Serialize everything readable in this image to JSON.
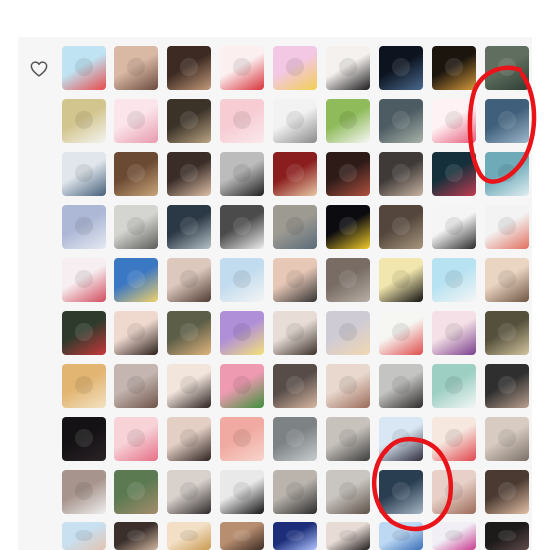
{
  "icons": {
    "like": "heart-outline-icon"
  },
  "colors": {
    "panel_background": "#f6f6f6",
    "annotation_ring": "#e8141a",
    "heart_stroke": "#555555"
  },
  "avatar_rows": [
    [
      {
        "c1": "#bfe3f2",
        "c2": "#e94a4a",
        "tone": "light"
      },
      {
        "c1": "#d9b8a4",
        "c2": "#6b4b3e",
        "tone": "light"
      },
      {
        "c1": "#3d2a22",
        "c2": "#c29a7a",
        "tone": "dark"
      },
      {
        "c1": "#fbeff0",
        "c2": "#d7323a",
        "tone": "light"
      },
      {
        "c1": "#f3c8e4",
        "c2": "#f2cf52",
        "tone": "light"
      },
      {
        "c1": "#f4f1ee",
        "c2": "#1c1a1c",
        "tone": "light"
      },
      {
        "c1": "#0d1420",
        "c2": "#4a6a8e",
        "tone": "dark"
      },
      {
        "c1": "#1c150e",
        "c2": "#d59a3c",
        "tone": "dark"
      },
      {
        "c1": "#5f6e5e",
        "c2": "#2d3e35",
        "tone": "dark"
      }
    ],
    [
      {
        "c1": "#d3c58e",
        "c2": "#f4f4f2",
        "tone": "light"
      },
      {
        "c1": "#fbe4ea",
        "c2": "#e79aae",
        "tone": "light"
      },
      {
        "c1": "#3b3228",
        "c2": "#bba583",
        "tone": "dark"
      },
      {
        "c1": "#f7ccd3",
        "c2": "#fae9ec",
        "tone": "light"
      },
      {
        "c1": "#f2f2f2",
        "c2": "#8a8a8a",
        "tone": "light"
      },
      {
        "c1": "#8fbb5a",
        "c2": "#f8f8f8",
        "tone": "light"
      },
      {
        "c1": "#4d5c63",
        "c2": "#a9b3a9",
        "tone": "dark"
      },
      {
        "c1": "#fff2f4",
        "c2": "#e45b7a",
        "tone": "light"
      },
      {
        "c1": "#3f5f7a",
        "c2": "#9fb8cc",
        "tone": "dark"
      }
    ],
    [
      {
        "c1": "#e0e6ec",
        "c2": "#45607a",
        "tone": "light"
      },
      {
        "c1": "#6b4a33",
        "c2": "#c9a67b",
        "tone": "dark"
      },
      {
        "c1": "#3a2d28",
        "c2": "#e0c0a7",
        "tone": "dark"
      },
      {
        "c1": "#bcbcbc",
        "c2": "#1f1f1f",
        "tone": "light"
      },
      {
        "c1": "#8a1d1d",
        "c2": "#e8c9a6",
        "tone": "dark"
      },
      {
        "c1": "#2e1b18",
        "c2": "#b05240",
        "tone": "dark"
      },
      {
        "c1": "#3f3a38",
        "c2": "#c8b3a2",
        "tone": "dark"
      },
      {
        "c1": "#15303a",
        "c2": "#c23b53",
        "tone": "dark"
      },
      {
        "c1": "#6eaab8",
        "c2": "#e1eef2",
        "tone": "light"
      }
    ],
    [
      {
        "c1": "#adb8d6",
        "c2": "#e6e9f2",
        "tone": "light"
      },
      {
        "c1": "#d4d4d0",
        "c2": "#5c5c58",
        "tone": "light"
      },
      {
        "c1": "#2b3845",
        "c2": "#b6c2c8",
        "tone": "dark"
      },
      {
        "c1": "#4b4b4b",
        "c2": "#eeeeee",
        "tone": "dark"
      },
      {
        "c1": "#9d9a92",
        "c2": "#5a6b78",
        "tone": "light"
      },
      {
        "c1": "#0c0c10",
        "c2": "#f1cc2a",
        "tone": "dark"
      },
      {
        "c1": "#54463c",
        "c2": "#a8977f",
        "tone": "dark"
      },
      {
        "c1": "#f5f5f5",
        "c2": "#2a2a2a",
        "tone": "light"
      },
      {
        "c1": "#f3f3f3",
        "c2": "#e0705e",
        "tone": "light"
      }
    ],
    [
      {
        "c1": "#f6eef0",
        "c2": "#d14c5e",
        "tone": "light"
      },
      {
        "c1": "#3b78c3",
        "c2": "#f2d16b",
        "tone": "dark"
      },
      {
        "c1": "#dcc8bd",
        "c2": "#4e3a30",
        "tone": "light"
      },
      {
        "c1": "#c2dcef",
        "c2": "#f4f4f4",
        "tone": "light"
      },
      {
        "c1": "#e7c8b7",
        "c2": "#333333",
        "tone": "light"
      },
      {
        "c1": "#786c64",
        "c2": "#b8afa6",
        "tone": "dark"
      },
      {
        "c1": "#f1e6ae",
        "c2": "#111111",
        "tone": "light"
      },
      {
        "c1": "#b7e2f1",
        "c2": "#f5f5f5",
        "tone": "light"
      },
      {
        "c1": "#ead4c2",
        "c2": "#6e5443",
        "tone": "light"
      }
    ],
    [
      {
        "c1": "#2e3b2c",
        "c2": "#c8373b",
        "tone": "dark"
      },
      {
        "c1": "#efd9cf",
        "c2": "#2a1e1a",
        "tone": "light"
      },
      {
        "c1": "#5d5e48",
        "c2": "#e0b57d",
        "tone": "dark"
      },
      {
        "c1": "#b08fd9",
        "c2": "#f4e27a",
        "tone": "light"
      },
      {
        "c1": "#e7ddd6",
        "c2": "#3a2f2a",
        "tone": "light"
      },
      {
        "c1": "#cfcbd5",
        "c2": "#f1d7b0",
        "tone": "light"
      },
      {
        "c1": "#f6f6f2",
        "c2": "#e04c4c",
        "tone": "light"
      },
      {
        "c1": "#f4e0e6",
        "c2": "#7a3e8c",
        "tone": "light"
      },
      {
        "c1": "#55503c",
        "c2": "#d3c59f",
        "tone": "dark"
      }
    ],
    [
      {
        "c1": "#e2b572",
        "c2": "#f3e2c3",
        "tone": "light"
      },
      {
        "c1": "#c4b5b0",
        "c2": "#6e5348",
        "tone": "light"
      },
      {
        "c1": "#f2e5dc",
        "c2": "#2b2120",
        "tone": "light"
      },
      {
        "c1": "#ee9bb2",
        "c2": "#3e8f3b",
        "tone": "light"
      },
      {
        "c1": "#574c48",
        "c2": "#d8b8a3",
        "tone": "dark"
      },
      {
        "c1": "#e9d8ce",
        "c2": "#9a6b58",
        "tone": "light"
      },
      {
        "c1": "#c4c4c2",
        "c2": "#2c2a2a",
        "tone": "light"
      },
      {
        "c1": "#9ecfc3",
        "c2": "#f4f7f6",
        "tone": "light"
      },
      {
        "c1": "#2f2f2f",
        "c2": "#bba190",
        "tone": "dark"
      }
    ],
    [
      {
        "c1": "#141214",
        "c2": "#2b2327",
        "tone": "dark"
      },
      {
        "c1": "#f7d3d8",
        "c2": "#e56f86",
        "tone": "light"
      },
      {
        "c1": "#e3cfc4",
        "c2": "#2d2220",
        "tone": "light"
      },
      {
        "c1": "#f0aaa1",
        "c2": "#f7d4cc",
        "tone": "light"
      },
      {
        "c1": "#7d8284",
        "c2": "#c9cfd0",
        "tone": "dark"
      },
      {
        "c1": "#c7c2bc",
        "c2": "#3d3d3d",
        "tone": "light"
      },
      {
        "c1": "#d9e6f4",
        "c2": "#2e2b3a",
        "tone": "light"
      },
      {
        "c1": "#f6e7df",
        "c2": "#e0474d",
        "tone": "light"
      },
      {
        "c1": "#d8ccc2",
        "c2": "#7b7067",
        "tone": "light"
      }
    ],
    [
      {
        "c1": "#a7948c",
        "c2": "#efefef",
        "tone": "light"
      },
      {
        "c1": "#5c7a52",
        "c2": "#a58c6c",
        "tone": "dark"
      },
      {
        "c1": "#d8d1cc",
        "c2": "#2d2728",
        "tone": "light"
      },
      {
        "c1": "#e9e9e9",
        "c2": "#121212",
        "tone": "light"
      },
      {
        "c1": "#bab4ad",
        "c2": "#2a2a2a",
        "tone": "light"
      },
      {
        "c1": "#c9c5c0",
        "c2": "#5d4f47",
        "tone": "light"
      },
      {
        "c1": "#2a3e52",
        "c2": "#a7b6c4",
        "tone": "dark"
      },
      {
        "c1": "#e8d0c8",
        "c2": "#9b6a58",
        "tone": "light"
      },
      {
        "c1": "#4b3a31",
        "c2": "#e3c0a7",
        "tone": "dark"
      }
    ],
    [
      {
        "c1": "#c8e0f0",
        "c2": "#e4c2b0",
        "tone": "light"
      },
      {
        "c1": "#3a2f2b",
        "c2": "#d3b7a0",
        "tone": "dark"
      },
      {
        "c1": "#f2dfc5",
        "c2": "#c99a4f",
        "tone": "light"
      },
      {
        "c1": "#b88e70",
        "c2": "#3c2b25",
        "tone": "dark"
      },
      {
        "c1": "#1c2e7a",
        "c2": "#b3c6ff",
        "tone": "dark"
      },
      {
        "c1": "#e7dbd5",
        "c2": "#1e1a1a",
        "tone": "light"
      },
      {
        "c1": "#bcd8f3",
        "c2": "#3a6fb6",
        "tone": "light"
      },
      {
        "c1": "#f1eef6",
        "c2": "#c73a8f",
        "tone": "light"
      },
      {
        "c1": "#1d1a1a",
        "c2": "#5f4b4b",
        "tone": "dark"
      }
    ]
  ]
}
